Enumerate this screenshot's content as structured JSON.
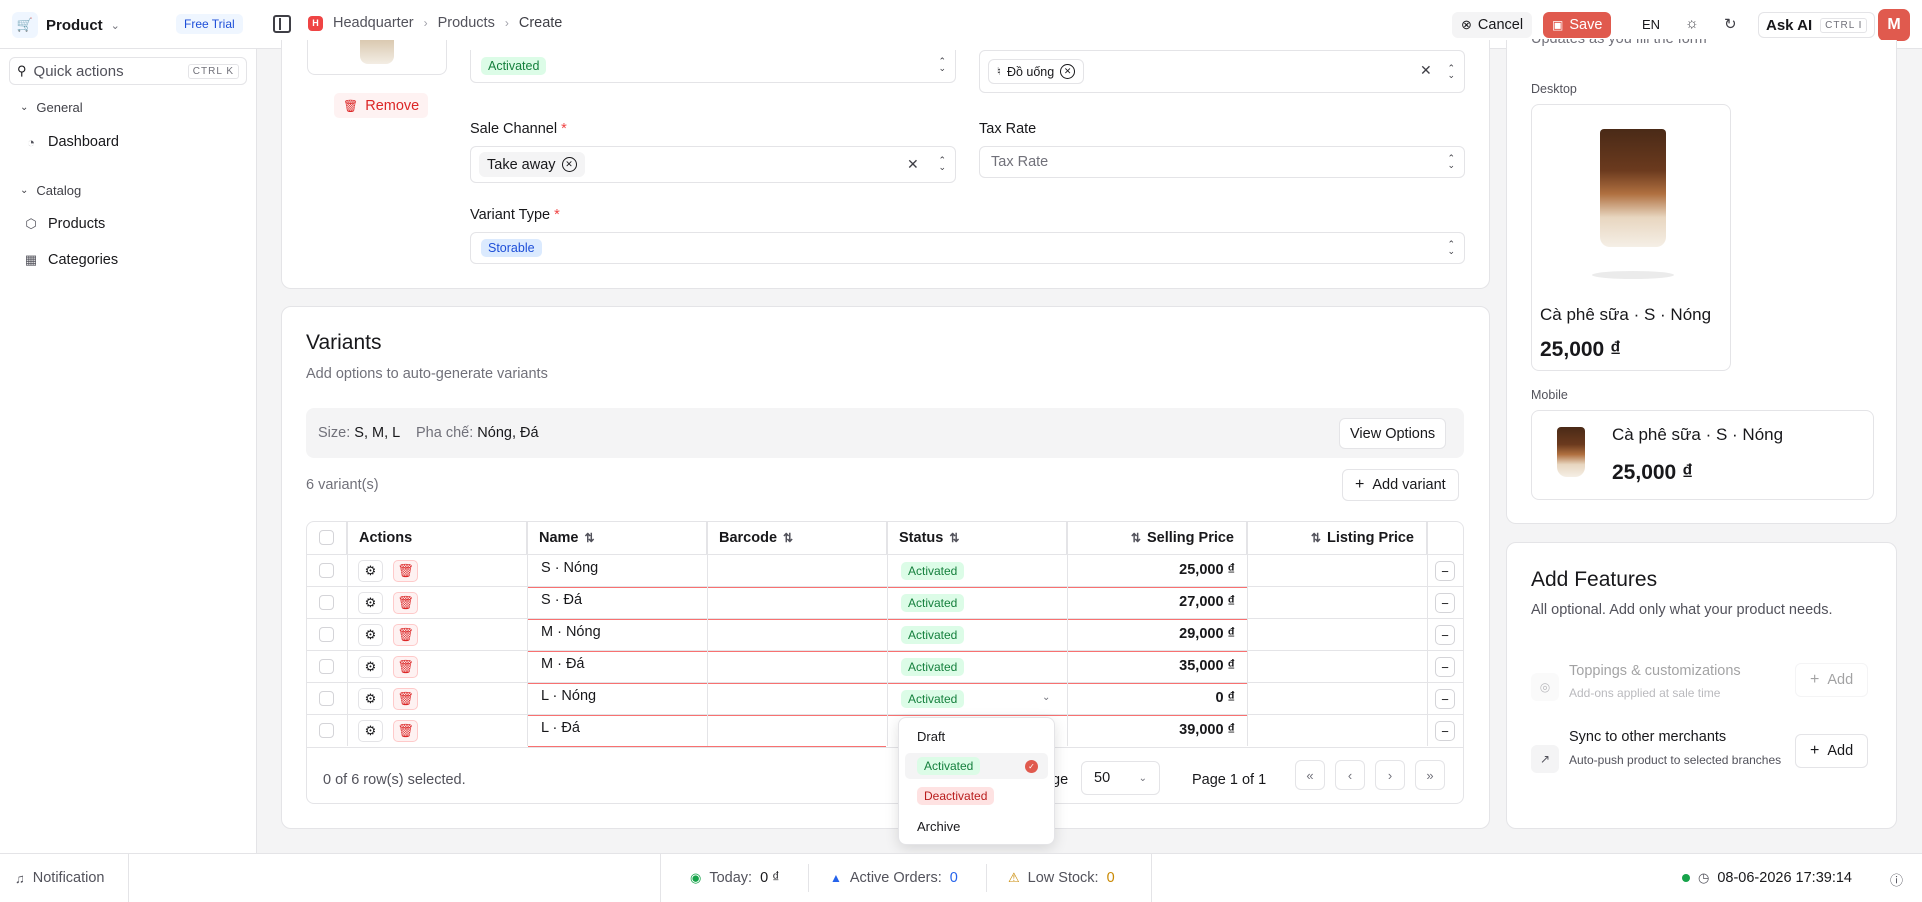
{
  "app": {
    "name": "Product",
    "plan_badge": "Free Trial"
  },
  "breadcrumb": {
    "items": [
      "Headquarter",
      "Products",
      "Create"
    ],
    "logo_letter": "H"
  },
  "toolbar": {
    "cancel_label": "Cancel",
    "save_label": "Save",
    "language": "EN",
    "ask_ai_label": "Ask AI",
    "ask_ai_shortcut": "CTRL I",
    "avatar_initial": "M"
  },
  "sidebar": {
    "quick_actions_label": "Quick actions",
    "quick_actions_shortcut": "CTRL K",
    "groups": [
      {
        "label": "General",
        "items": [
          {
            "label": "Dashboard",
            "icon": "dashboard-icon"
          }
        ]
      },
      {
        "label": "Catalog",
        "items": [
          {
            "label": "Products",
            "icon": "package-icon"
          },
          {
            "label": "Categories",
            "icon": "grid-icon"
          }
        ]
      }
    ]
  },
  "form": {
    "remove_label": "Remove",
    "status_value": "Activated",
    "category_tag": "Đồ uống",
    "sale_channel": {
      "label": "Sale Channel",
      "value": "Take away"
    },
    "tax_rate": {
      "label": "Tax Rate",
      "placeholder": "Tax Rate"
    },
    "variant_type": {
      "label": "Variant Type",
      "value": "Storable"
    },
    "required_mark": "*"
  },
  "variants": {
    "title": "Variants",
    "subtitle": "Add options to auto-generate variants",
    "options": [
      {
        "name": "Size:",
        "values": "S, M, L"
      },
      {
        "name": "Pha chế:",
        "values": "Nóng, Đá"
      }
    ],
    "view_options_label": "View Options",
    "count_label": "6 variant(s)",
    "add_variant_label": "Add variant",
    "columns": [
      "Actions",
      "Name",
      "Barcode",
      "Status",
      "Selling Price",
      "Listing Price"
    ],
    "rows": [
      {
        "name": "S · Nóng",
        "barcode": "",
        "status": "Activated",
        "selling_price": "25,000 ₫",
        "listing_price": ""
      },
      {
        "name": "S · Đá",
        "barcode": "",
        "status": "Activated",
        "selling_price": "27,000 ₫",
        "listing_price": ""
      },
      {
        "name": "M · Nóng",
        "barcode": "",
        "status": "Activated",
        "selling_price": "29,000 ₫",
        "listing_price": ""
      },
      {
        "name": "M · Đá",
        "barcode": "",
        "status": "Activated",
        "selling_price": "35,000 ₫",
        "listing_price": ""
      },
      {
        "name": "L · Nóng",
        "barcode": "",
        "status": "Activated",
        "selling_price": "0 ₫",
        "listing_price": ""
      },
      {
        "name": "L · Đá",
        "barcode": "",
        "status": "",
        "selling_price": "39,000 ₫",
        "listing_price": ""
      }
    ],
    "selection_label": "0 of 6 row(s) selected.",
    "rows_per_page_partial": "ge",
    "page_size": "50",
    "page_label": "Page 1 of 1"
  },
  "status_dropdown": {
    "options": [
      "Draft",
      "Activated",
      "Deactivated",
      "Archive"
    ],
    "selected": "Activated"
  },
  "preview": {
    "subtitle_partial": "Updates as you fill the form",
    "desktop_label": "Desktop",
    "mobile_label": "Mobile",
    "product_name": "Cà phê sữa · S · Nóng",
    "price": "25,000 ₫"
  },
  "features": {
    "title": "Add Features",
    "subtitle": "All optional. Add only what your product needs.",
    "items": [
      {
        "title": "Toppings & customizations",
        "desc": "Add-ons applied at sale time",
        "button": "Add",
        "disabled": true
      },
      {
        "title": "Sync to other merchants",
        "desc": "Auto-push product to selected branches",
        "button": "Add",
        "disabled": false
      }
    ]
  },
  "statusbar": {
    "notification_label": "Notification",
    "today_label": "Today:",
    "today_value": "0 ₫",
    "orders_label": "Active Orders:",
    "orders_value": "0",
    "stock_label": "Low Stock:",
    "stock_value": "0",
    "datetime": "08-06-2026 17:39:14"
  },
  "colors": {
    "accent": "#e05a4e",
    "success": "#15803d",
    "danger": "#dc2626",
    "info": "#1d4ed8"
  }
}
